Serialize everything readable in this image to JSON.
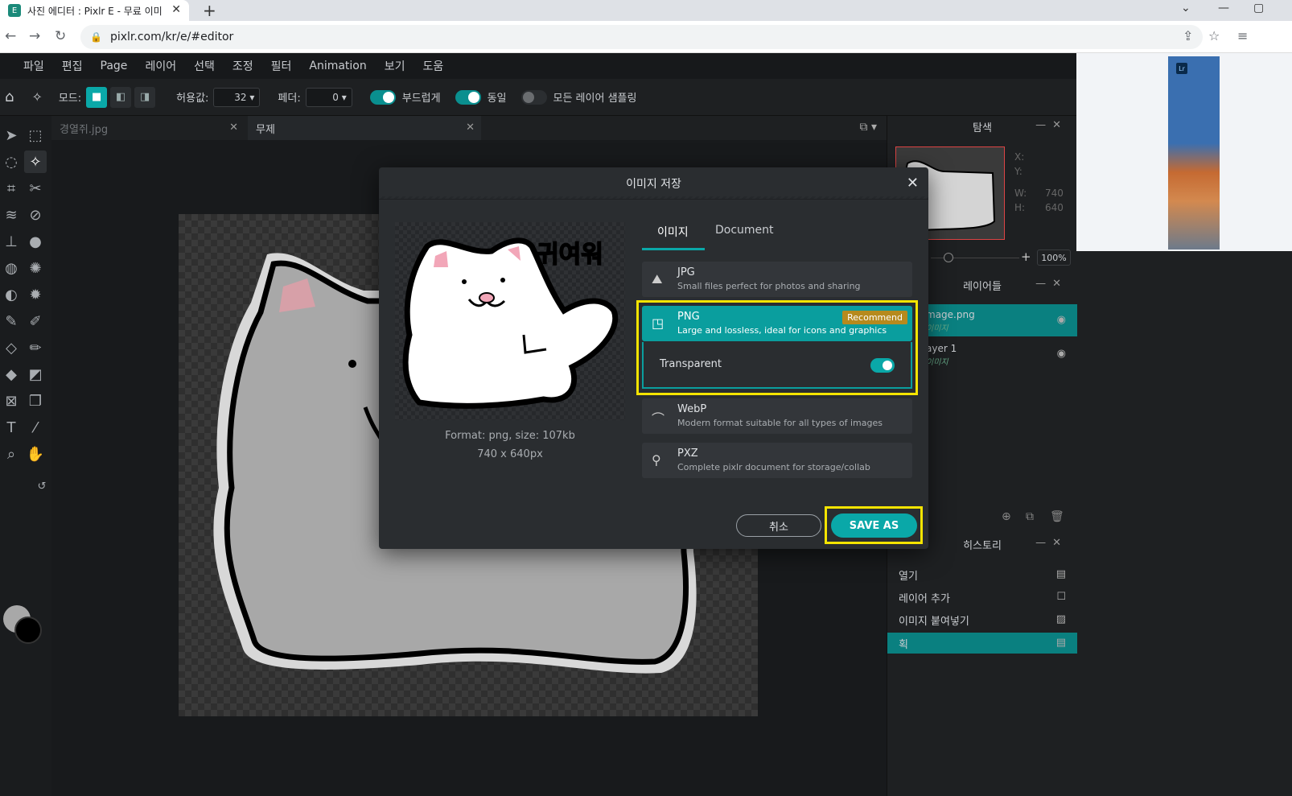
{
  "browser": {
    "tab_title": "사진 에디터 : Pixlr E - 무료 이미",
    "tab_favicon": "E",
    "url": "pixlr.com/kr/e/#editor"
  },
  "menu": [
    "파일",
    "편집",
    "Page",
    "레이어",
    "선택",
    "조정",
    "필터",
    "Animation",
    "보기",
    "도움"
  ],
  "options": {
    "mode_label": "모드:",
    "tolerance_label": "허용값:",
    "tolerance_value": "32",
    "feather_label": "페더:",
    "feather_value": "0",
    "smooth_label": "부드럽게",
    "contiguous_label": "동일",
    "sample_all_label": "모든 레이어 샘플링"
  },
  "doc_tabs": [
    "경열쥐.jpg",
    "무제"
  ],
  "panels": {
    "navigator_title": "탐색",
    "nav_x": "X:",
    "nav_y": "Y:",
    "nav_w_label": "W:",
    "nav_w": "740",
    "nav_h_label": "H:",
    "nav_h": "640",
    "zoom": "100%",
    "layers_title": "레이어들",
    "layers": [
      {
        "name": "mage.png",
        "sub": "이미지"
      },
      {
        "name": "ayer 1",
        "sub": "이미지"
      }
    ],
    "history_title": "히스토리",
    "history": [
      "열기",
      "레이어 추가",
      "이미지 붙여넣기",
      "획"
    ]
  },
  "dialog": {
    "title": "이미지 저장",
    "preview_text": "귀여워",
    "format_info": "Format: png, size: 107kb",
    "dimensions": "740 x 640px",
    "tabs": [
      "이미지",
      "Document"
    ],
    "formats": [
      {
        "name": "JPG",
        "desc": "Small files perfect for photos and sharing"
      },
      {
        "name": "PNG",
        "desc": "Large and lossless, ideal for icons and graphics",
        "badge": "Recommend"
      },
      {
        "name": "WebP",
        "desc": "Modern format suitable for all types of images"
      },
      {
        "name": "PXZ",
        "desc": "Complete pixlr document for storage/collab"
      }
    ],
    "transparent_label": "Transparent",
    "cancel_label": "취소",
    "save_label": "SAVE AS"
  },
  "colors": {
    "accent": "#0aa8a8",
    "highlight": "#f5e400",
    "badge": "#b68a1d"
  }
}
